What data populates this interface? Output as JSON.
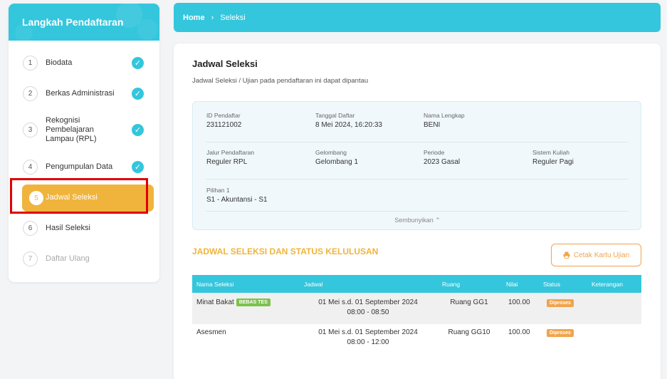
{
  "sidebar": {
    "title": "Langkah Pendaftaran",
    "steps": [
      {
        "num": "1",
        "label": "Biodata",
        "done": true
      },
      {
        "num": "2",
        "label": "Berkas Administrasi",
        "done": true
      },
      {
        "num": "3",
        "label": "Rekognisi Pembelajaran Lampau (RPL)",
        "done": true
      },
      {
        "num": "4",
        "label": "Pengumpulan Data",
        "done": true
      },
      {
        "num": "5",
        "label": "Jadwal Seleksi",
        "active": true
      },
      {
        "num": "6",
        "label": "Hasil Seleksi"
      },
      {
        "num": "7",
        "label": "Daftar Ulang",
        "disabled": true
      }
    ],
    "check_glyph": "✓"
  },
  "breadcrumb": {
    "home": "Home",
    "separator": "›",
    "current": "Seleksi"
  },
  "card": {
    "title": "Jadwal Seleksi",
    "subtitle": "Jadwal Seleksi / Ujian pada pendaftaran ini dapat dipantau",
    "info": {
      "id_label": "ID Pendaftar",
      "id_value": "231121002",
      "tgl_label": "Tanggal Daftar",
      "tgl_value": "8 Mei 2024, 16:20:33",
      "nama_label": "Nama Lengkap",
      "nama_value": "BENI",
      "jalur_label": "Jalur Pendaftaran",
      "jalur_value": "Reguler RPL",
      "gel_label": "Gelombang",
      "gel_value": "Gelombang 1",
      "periode_label": "Periode",
      "periode_value": "2023 Gasal",
      "sistem_label": "Sistem Kuliah",
      "sistem_value": "Reguler Pagi",
      "pilihan_label": "Pilihan 1",
      "pilihan_value": "S1 - Akuntansi - S1",
      "toggle_label": "Sembunyikan ⌃"
    },
    "section_title": "JADWAL SELEKSI DAN STATUS KELULUSAN",
    "print_button": "Cetak Kartu Ujian",
    "table": {
      "headers": {
        "nama": "Nama Seleksi",
        "jadwal": "Jadwal",
        "ruang": "Ruang",
        "nilai": "Nilai",
        "status": "Status",
        "ket": "Keterangan"
      },
      "rows": [
        {
          "nama": "Minat Bakat",
          "badge": "BEBAS TES",
          "jadwal1": "01 Mei s.d. 01 September 2024",
          "jadwal2": "08:00 - 08:50",
          "ruang": "Ruang GG1",
          "nilai": "100.00",
          "status": "Diproses",
          "ket": ""
        },
        {
          "nama": "Asesmen",
          "badge": "",
          "jadwal1": "01 Mei s.d. 01 September 2024",
          "jadwal2": "08:00 - 12:00",
          "ruang": "Ruang GG10",
          "nilai": "100.00",
          "status": "Diproses",
          "ket": ""
        }
      ]
    }
  },
  "colors": {
    "primary": "#34c6dc",
    "accent": "#f0b43c",
    "highlight": "#e00000",
    "success": "#7cc24a",
    "status": "#f0a44c"
  }
}
